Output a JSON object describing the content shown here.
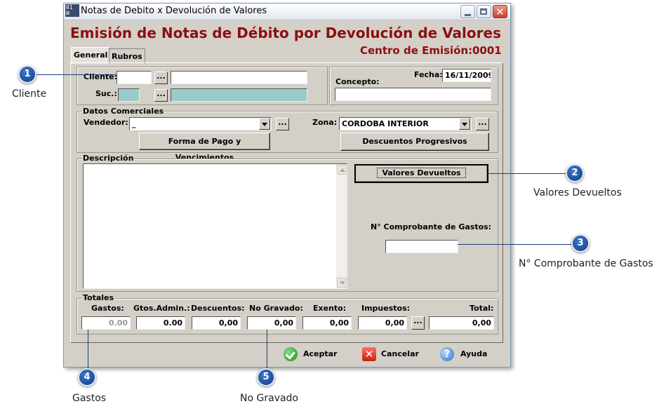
{
  "window": {
    "icon_text": "01 ⊠",
    "title": "Notas de Debito x Devolución de Valores",
    "controls": {
      "minimize": "minimize-icon",
      "maximize": "maximize-icon",
      "close": "close-icon",
      "close_glyph": "✕"
    }
  },
  "header": {
    "title": "Emisión de Notas de Débito por Devolución de Valores",
    "centro_label": "Centro de Emisión:",
    "centro_value": "0001",
    "accent_color": "#8b1010"
  },
  "tabs": [
    {
      "label": "General",
      "active": true
    },
    {
      "label": "Rubros",
      "active": false
    }
  ],
  "cliente": {
    "cliente_label": "Cliente:",
    "cliente_code": "",
    "cliente_name": "",
    "suc_label": "Suc.:",
    "suc_code": "",
    "suc_name": "",
    "lookup_label": "..."
  },
  "fecha": {
    "label": "Fecha:",
    "value": "16/11/2009"
  },
  "concepto": {
    "label": "Concepto:",
    "value": ""
  },
  "datos_comerciales": {
    "title": "Datos Comerciales",
    "vendedor_label": "Vendedor:",
    "vendedor_value": "_",
    "zona_label": "Zona:",
    "zona_value": "CORDOBA INTERIOR",
    "forma_pago_button": "Forma de Pago y Vencimientos",
    "descuentos_button": "Descuentos Progresivos"
  },
  "descripcion": {
    "title": "Descripción",
    "value": "",
    "valores_devueltos_button": "Valores Devueltos",
    "comprobante_label": "N° Comprobante de Gastos:",
    "comprobante_value": ""
  },
  "totales": {
    "title": "Totales",
    "columns": [
      {
        "label": "Gastos:",
        "value": "0.00"
      },
      {
        "label": "Gtos.Admin.:",
        "value": "0.00"
      },
      {
        "label": "Descuentos:",
        "value": "0,00"
      },
      {
        "label": "No Gravado:",
        "value": "0,00"
      },
      {
        "label": "Exento:",
        "value": "0,00"
      },
      {
        "label": "Impuestos:",
        "value": "0,00"
      },
      {
        "label": "Total:",
        "value": "0,00"
      }
    ]
  },
  "actions": {
    "accept": {
      "label": "Aceptar",
      "icon": "check-icon"
    },
    "cancel": {
      "label": "Cancelar",
      "icon": "cancel-x-icon",
      "glyph": "✕"
    },
    "help": {
      "label": "Ayuda",
      "icon": "help-icon",
      "glyph": "?"
    }
  },
  "callouts": [
    {
      "number": "1",
      "label": "Cliente"
    },
    {
      "number": "2",
      "label": "Valores Devueltos"
    },
    {
      "number": "3",
      "label": "N° Comprobante de Gastos"
    },
    {
      "number": "4",
      "label": "Gastos"
    },
    {
      "number": "5",
      "label": "No Gravado"
    }
  ]
}
